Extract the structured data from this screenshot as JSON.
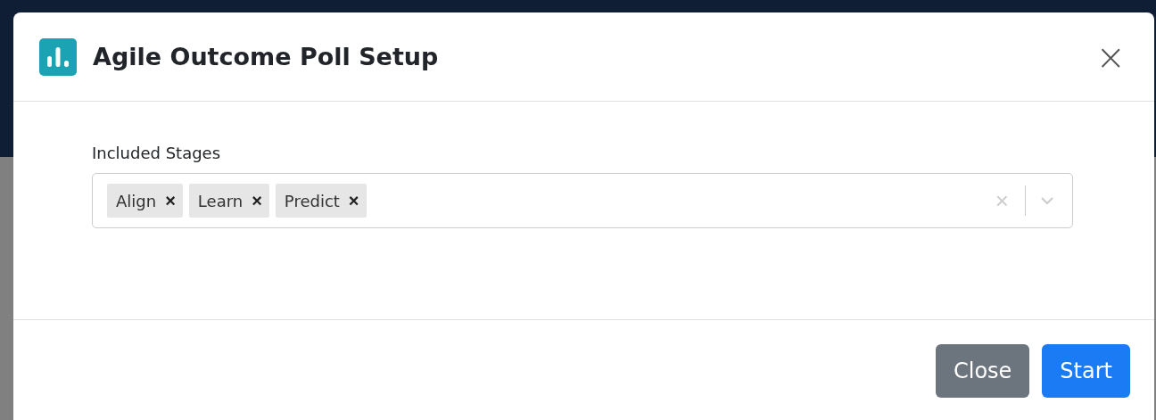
{
  "modal": {
    "title": "Agile Outcome Poll Setup",
    "close_label": "×",
    "field": {
      "label": "Included Stages",
      "tags": [
        {
          "label": "Align",
          "remove": "×"
        },
        {
          "label": "Learn",
          "remove": "×"
        },
        {
          "label": "Predict",
          "remove": "×"
        }
      ],
      "clear": "×"
    },
    "buttons": [
      {
        "label": "Close",
        "kind": "secondary"
      },
      {
        "label": "Start",
        "kind": "primary"
      }
    ]
  }
}
